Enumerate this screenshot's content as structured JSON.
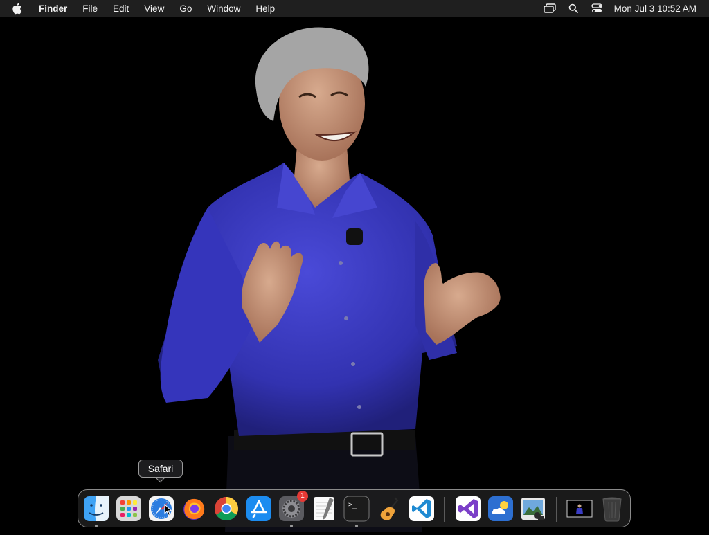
{
  "menubar": {
    "app_name": "Finder",
    "items": [
      "File",
      "Edit",
      "View",
      "Go",
      "Window",
      "Help"
    ],
    "clock": "Mon Jul 3  10:52 AM",
    "icons": [
      "apple-icon",
      "screen-mirroring-icon",
      "spotlight-search-icon",
      "control-center-icon"
    ]
  },
  "tooltip": {
    "label": "Safari"
  },
  "dock": {
    "items": [
      {
        "name": "Finder",
        "icon": "finder-icon"
      },
      {
        "name": "Launchpad",
        "icon": "launchpad-icon"
      },
      {
        "name": "Safari",
        "icon": "safari-icon"
      },
      {
        "name": "Firefox",
        "icon": "firefox-icon"
      },
      {
        "name": "Chrome",
        "icon": "chrome-icon"
      },
      {
        "name": "App Store",
        "icon": "app-store-icon"
      },
      {
        "name": "System Settings",
        "icon": "system-settings-icon",
        "badge": "1"
      },
      {
        "name": "TextEdit",
        "icon": "textedit-icon"
      },
      {
        "name": "Terminal",
        "icon": "terminal-icon",
        "glyph": ">_"
      },
      {
        "name": "GarageBand",
        "icon": "garageband-icon"
      },
      {
        "name": "Visual Studio Code",
        "icon": "vscode-icon"
      },
      {
        "name": "Visual Studio",
        "icon": "visual-studio-icon"
      },
      {
        "name": "Weather",
        "icon": "weather-icon"
      },
      {
        "name": "Preview",
        "icon": "preview-icon"
      },
      {
        "name": "Desktop image",
        "icon": "minimized-window-icon"
      },
      {
        "name": "Trash",
        "icon": "trash-icon"
      }
    ]
  },
  "colors": {
    "menubar_bg": "#1f1f1f",
    "shirt_blue": "#3a3cc4",
    "dock_border": "#8a8a8a"
  }
}
